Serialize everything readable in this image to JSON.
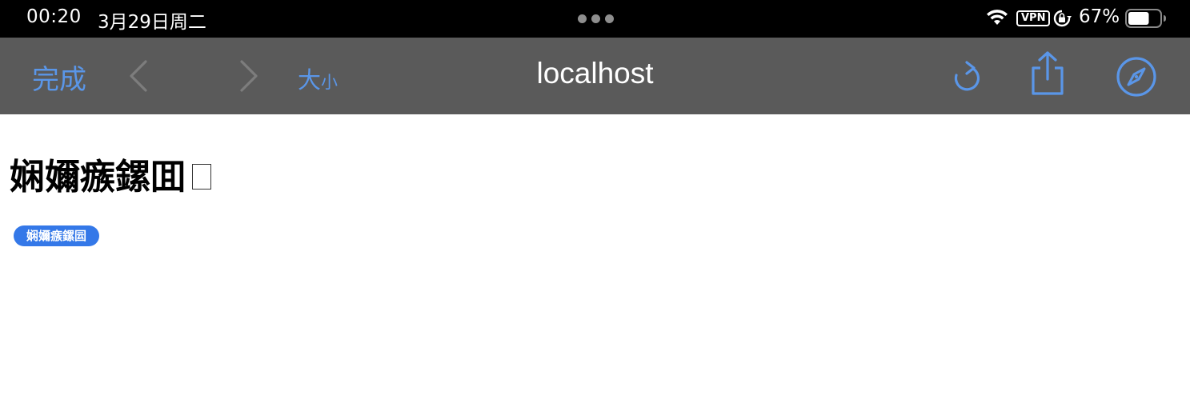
{
  "status_bar": {
    "time": "00:20",
    "date": "3月29日周二",
    "vpn_label": "VPN",
    "battery_percent": "67%",
    "battery_level": 0.67,
    "icons": [
      "wifi-icon",
      "lock-rotation-icon",
      "battery-icon"
    ],
    "multitask_indicator": "three-dots"
  },
  "toolbar": {
    "done_label": "完成",
    "text_size_big": "大",
    "text_size_small": "小",
    "address_title": "localhost",
    "back_icon": "chevron-left-icon",
    "forward_icon": "chevron-right-icon",
    "reload_icon": "reload-icon",
    "share_icon": "share-icon",
    "safari_icon": "compass-icon",
    "accent_color": "#5a96e8",
    "background_color": "#5a5a5a"
  },
  "content": {
    "heading": "娴嬭瘯鏍囬",
    "badge_label": "娴嬭瘯鏍囩",
    "badge_color": "#3478e8"
  }
}
